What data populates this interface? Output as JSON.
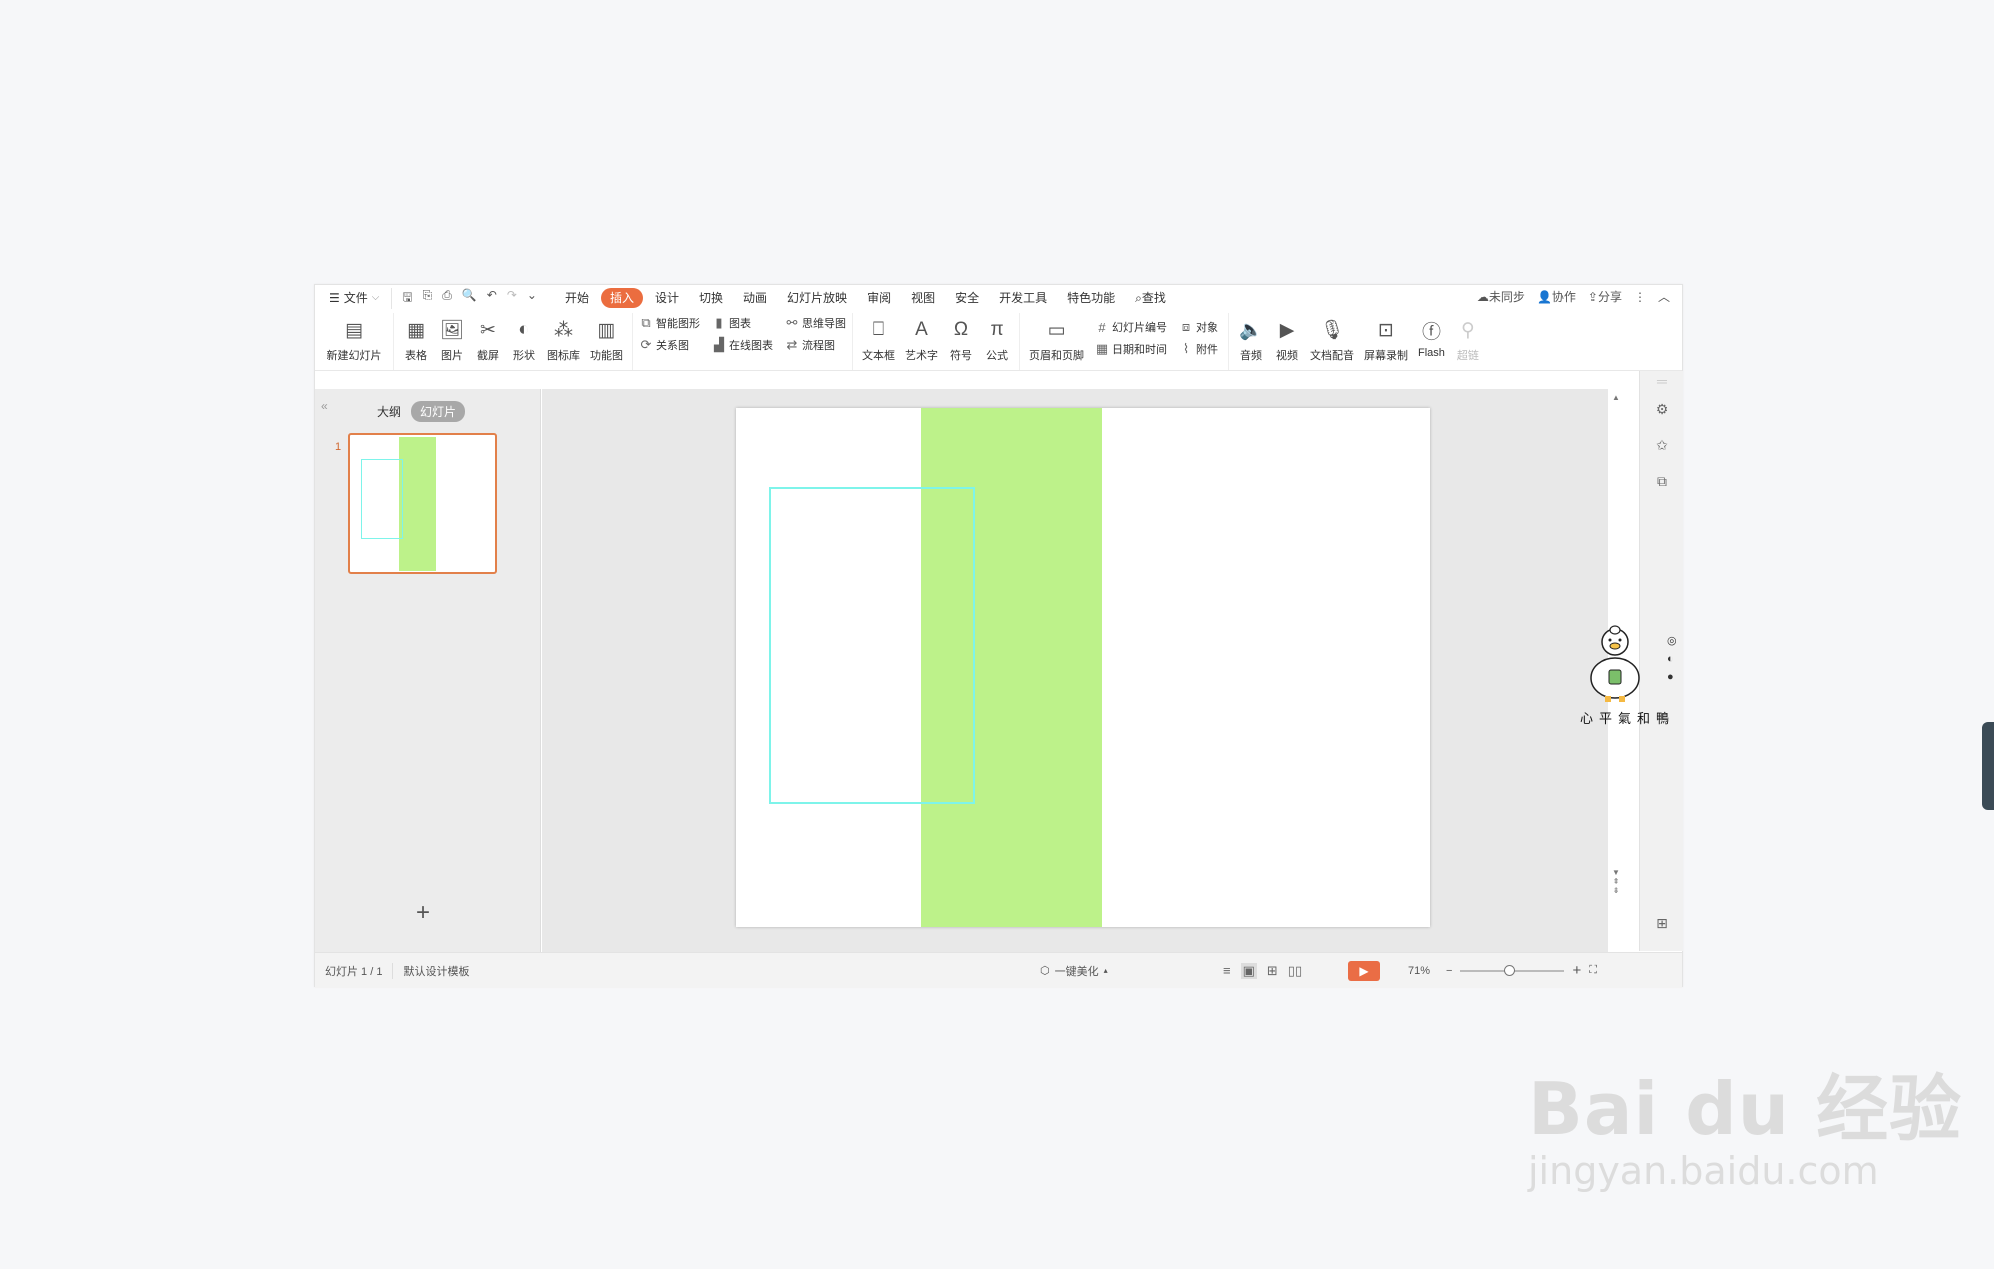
{
  "menubar": {
    "file_label": "文件",
    "tabs": [
      "开始",
      "插入",
      "设计",
      "切换",
      "动画",
      "幻灯片放映",
      "审阅",
      "视图",
      "安全",
      "开发工具",
      "特色功能"
    ],
    "active_tab": "插入",
    "search_label": "查找",
    "sync_label": "未同步",
    "collab_label": "协作",
    "share_label": "分享"
  },
  "ribbon": {
    "new_slide": "新建幻灯片",
    "table": "表格",
    "picture": "图片",
    "screenshot": "截屏",
    "shape": "形状",
    "icon_lib": "图标库",
    "func_chart": "功能图",
    "smart_art": "智能图形",
    "chart": "图表",
    "relation": "关系图",
    "online_chart": "在线图表",
    "mindmap": "思维导图",
    "flowchart": "流程图",
    "textbox": "文本框",
    "wordart": "艺术字",
    "symbol": "符号",
    "formula": "公式",
    "header_footer": "页眉和页脚",
    "slide_number": "幻灯片编号",
    "datetime": "日期和时间",
    "object": "对象",
    "attachment": "附件",
    "audio": "音频",
    "video": "视频",
    "doc_voice": "文档配音",
    "screen_record": "屏幕录制",
    "flash": "Flash",
    "hyperlink": "超链"
  },
  "panel": {
    "tab_outline": "大纲",
    "tab_slides": "幻灯片",
    "slide_index": "1"
  },
  "status": {
    "slide_count": "幻灯片 1 / 1",
    "template": "默认设计模板",
    "beautify": "一键美化",
    "zoom": "71%"
  },
  "sticker": {
    "caption": "心平氣和鴨"
  },
  "watermark": {
    "brand": "Bai du 经验",
    "url": "jingyan.baidu.com"
  },
  "colors": {
    "accent": "#eb6d3f",
    "slide_green": "#bdf28a",
    "outline_cyan": "#7ef4ea"
  }
}
